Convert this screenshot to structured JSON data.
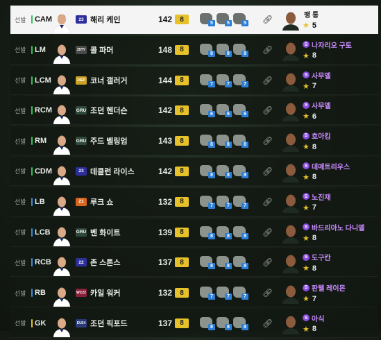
{
  "colors": {
    "accent_level": "#e6c12a",
    "tactic_num": "#2d7fd6",
    "coach_purple": "#c98cff"
  },
  "rows": [
    {
      "status": "선발",
      "pos": "CAM",
      "pos_color": "#33c45a",
      "badge": "23",
      "badge_color": "#2e2f9e",
      "name": "해리 케인",
      "ovr": "142",
      "level": "8",
      "tactics": [
        "5",
        "5",
        "5"
      ],
      "coach": "팽 통",
      "coach_icon": false,
      "coach_rating": "5",
      "selected": true
    },
    {
      "status": "선발",
      "pos": "LM",
      "pos_color": "#33c45a",
      "badge": "25TY",
      "badge_color": "#4a4a4a",
      "name": "콜 파머",
      "ovr": "148",
      "level": "8",
      "tactics": [
        "8",
        "8",
        "8"
      ],
      "coach": "나자리오 구토",
      "coach_icon": true,
      "coach_rating": "8",
      "selected": false
    },
    {
      "status": "선발",
      "pos": "LCM",
      "pos_color": "#33c45a",
      "badge": "24EP",
      "badge_color": "#c9a227",
      "name": "코너 갤러거",
      "ovr": "144",
      "level": "8",
      "tactics": [
        "7",
        "7",
        "7"
      ],
      "coach": "사무엘",
      "coach_icon": true,
      "coach_rating": "7",
      "selected": false
    },
    {
      "status": "선발",
      "pos": "RCM",
      "pos_color": "#33c45a",
      "badge": "GRU",
      "badge_color": "#2f4a3a",
      "name": "조던 헨더슨",
      "ovr": "142",
      "level": "8",
      "tactics": [
        "6",
        "6",
        "6"
      ],
      "coach": "사무엘",
      "coach_icon": true,
      "coach_rating": "6",
      "selected": false
    },
    {
      "status": "선발",
      "pos": "RM",
      "pos_color": "#33c45a",
      "badge": "GRU",
      "badge_color": "#2f4a3a",
      "name": "주드 벨링엄",
      "ovr": "143",
      "level": "8",
      "tactics": [
        "8",
        "8",
        "8"
      ],
      "coach": "호아킴",
      "coach_icon": true,
      "coach_rating": "8",
      "selected": false
    },
    {
      "status": "선발",
      "pos": "CDM",
      "pos_color": "#33c45a",
      "badge": "23",
      "badge_color": "#2e2f9e",
      "name": "데클런 라이스",
      "ovr": "142",
      "level": "8",
      "tactics": [
        "8",
        "8",
        "8"
      ],
      "coach": "데메트리우스",
      "coach_icon": true,
      "coach_rating": "8",
      "selected": false
    },
    {
      "status": "선발",
      "pos": "LB",
      "pos_color": "#3b8fe0",
      "badge": "21",
      "badge_color": "#d9661f",
      "name": "루크 쇼",
      "ovr": "132",
      "level": "8",
      "tactics": [
        "7",
        "7",
        "7"
      ],
      "coach": "노진재",
      "coach_icon": true,
      "coach_rating": "7",
      "selected": false
    },
    {
      "status": "선발",
      "pos": "LCB",
      "pos_color": "#3b8fe0",
      "badge": "GRU",
      "badge_color": "#2f4a3a",
      "name": "벤 화이트",
      "ovr": "139",
      "level": "8",
      "tactics": [
        "8",
        "8",
        "8"
      ],
      "coach": "바드리아노 다니엘",
      "coach_icon": true,
      "coach_rating": "8",
      "selected": false
    },
    {
      "status": "선발",
      "pos": "RCB",
      "pos_color": "#3b8fe0",
      "badge": "22",
      "badge_color": "#2e2f9e",
      "name": "존 스톤스",
      "ovr": "137",
      "level": "8",
      "tactics": [
        "8",
        "8",
        "8"
      ],
      "coach": "도구칸",
      "coach_icon": true,
      "coach_rating": "8",
      "selected": false
    },
    {
      "status": "선발",
      "pos": "RB",
      "pos_color": "#3b8fe0",
      "badge": "WC22",
      "badge_color": "#8a1f3a",
      "name": "카일 워커",
      "ovr": "132",
      "level": "8",
      "tactics": [
        "7",
        "7",
        "7"
      ],
      "coach": "판텔 레이몬",
      "coach_icon": true,
      "coach_rating": "7",
      "selected": false
    },
    {
      "status": "선발",
      "pos": "GK",
      "pos_color": "#e6c12a",
      "badge": "EU24",
      "badge_color": "#2a3a7a",
      "name": "조던 픽포드",
      "ovr": "137",
      "level": "8",
      "tactics": [
        "8",
        "8",
        "8"
      ],
      "coach": "아식",
      "coach_icon": true,
      "coach_rating": "8",
      "selected": false
    }
  ]
}
